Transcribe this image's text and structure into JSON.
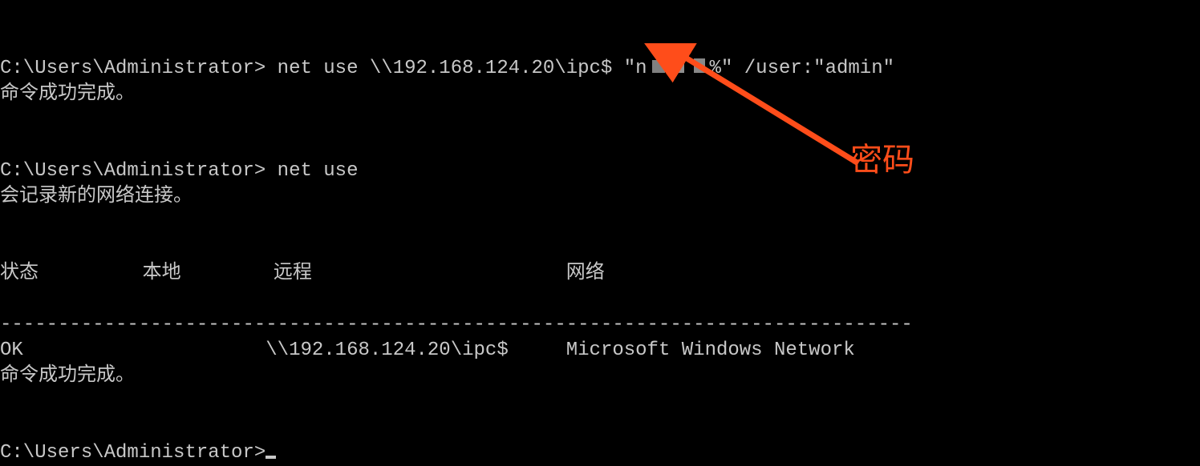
{
  "prompt": "C:\\Users\\Administrator>",
  "cmd1_prefix": " net use \\\\192.168.124.20\\ipc$ \"",
  "cmd1_pw_lead": "n",
  "cmd1_pw_tail": "%\"",
  "cmd1_suffix": " /user:\"admin\"",
  "resp1": "命令成功完成。",
  "cmd2": " net use",
  "resp2": "会记录新的网络连接。",
  "hdr_status": "状态",
  "hdr_local": "本地",
  "hdr_remote": "远程",
  "hdr_network": "网络",
  "sep": "-------------------------------------------------------------------------------",
  "row_status": "OK",
  "row_remote": "\\\\192.168.124.20\\ipc$",
  "row_network": "Microsoft Windows Network",
  "done": "命令成功完成。",
  "annotation": "密码"
}
